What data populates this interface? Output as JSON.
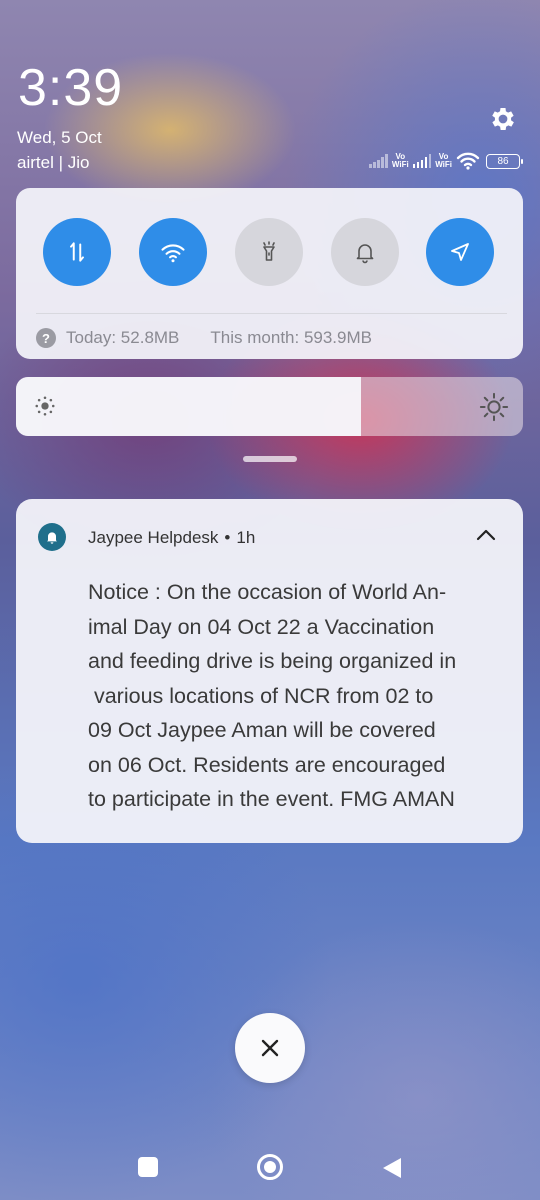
{
  "status": {
    "time": "3:39",
    "date": "Wed, 5 Oct",
    "carrier": "airtel | Jio",
    "vowifi_label_top": "Vo",
    "vowifi_label_bottom": "WiFi",
    "battery": "86"
  },
  "quick_settings": {
    "tiles": [
      {
        "name": "mobile-data",
        "icon": "data-arrows-icon",
        "on": true
      },
      {
        "name": "wifi",
        "icon": "wifi-icon",
        "on": true
      },
      {
        "name": "flashlight",
        "icon": "flashlight-icon",
        "on": false
      },
      {
        "name": "sound",
        "icon": "bell-icon",
        "on": false
      },
      {
        "name": "location",
        "icon": "location-arrow-icon",
        "on": true
      }
    ],
    "data_usage": {
      "help_glyph": "?",
      "today": "Today: 52.8MB",
      "month": "This month: 593.9MB"
    }
  },
  "brightness": {
    "level_percent": 68
  },
  "notification": {
    "app": "Jaypee Helpdesk",
    "separator": "•",
    "time": "1h",
    "lines": [
      "Notice : On the occasion of World An-",
      "imal Day on 04 Oct 22 a Vaccination",
      "and feeding drive is being organized in",
      " various locations of NCR from 02 to",
      "09 Oct Jaypee Aman will be covered",
      "on 06 Oct. Residents are encouraged",
      "to participate in the event. FMG AMAN"
    ]
  },
  "colors": {
    "accent_on": "#2f8de8",
    "tile_off": "#d6d6dc",
    "app_icon": "#1f6f8b"
  },
  "icons": {
    "dismiss": "close-icon",
    "settings": "gear-icon",
    "nav": [
      "recents-icon",
      "home-icon",
      "back-icon"
    ]
  }
}
